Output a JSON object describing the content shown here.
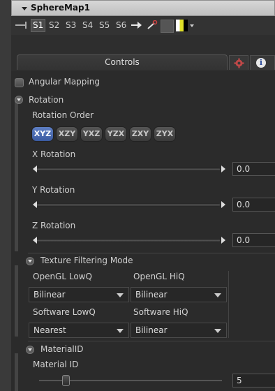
{
  "header": {
    "title": "SphereMap1"
  },
  "slots": [
    "S1",
    "S2",
    "S3",
    "S4",
    "S5",
    "S6"
  ],
  "tabs": {
    "controls": "Controls"
  },
  "angular_mapping": {
    "label": "Angular Mapping",
    "checked": false
  },
  "rotation": {
    "section": "Rotation",
    "order_label": "Rotation Order",
    "orders": [
      "XYZ",
      "XZY",
      "YXZ",
      "YZX",
      "ZXY",
      "ZYX"
    ],
    "selected": "XYZ",
    "x": {
      "label": "X Rotation",
      "value": "0.0"
    },
    "y": {
      "label": "Y Rotation",
      "value": "0.0"
    },
    "z": {
      "label": "Z Rotation",
      "value": "0.0"
    }
  },
  "filtering": {
    "section": "Texture Filtering Mode",
    "gl_low_label": "OpenGL LowQ",
    "gl_low_value": "Bilinear",
    "gl_hi_label": "OpenGL HiQ",
    "gl_hi_value": "Bilinear",
    "sw_low_label": "Software LowQ",
    "sw_low_value": "Nearest",
    "sw_hi_label": "Software HiQ",
    "sw_hi_value": "Bilinear"
  },
  "material": {
    "section": "MaterialID",
    "label": "Material ID",
    "value": "5"
  },
  "colors": {
    "accent": "#4a6bb3",
    "panel": "#2b2b2b",
    "header": "#c9c9c9"
  }
}
